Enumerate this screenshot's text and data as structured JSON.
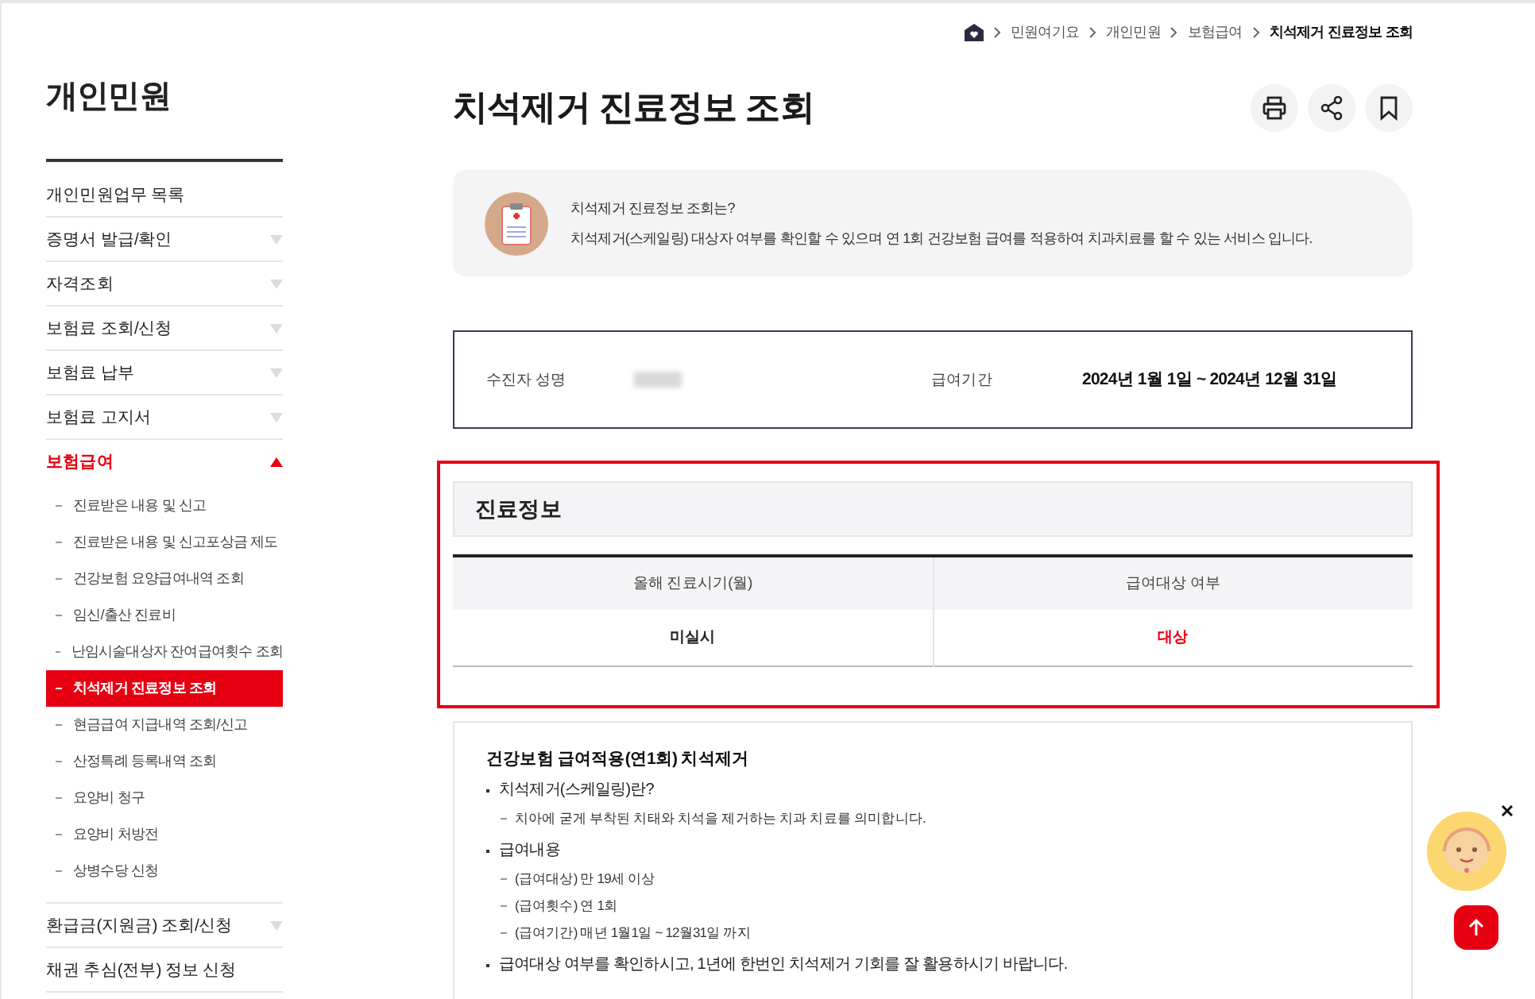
{
  "sidebar": {
    "title": "개인민원",
    "items": [
      {
        "label": "개인민원업무 목록",
        "kind": "link",
        "expanded": false
      },
      {
        "label": "증명서 발급/확인",
        "kind": "group",
        "expanded": false
      },
      {
        "label": "자격조회",
        "kind": "group",
        "expanded": false
      },
      {
        "label": "보험료 조회/신청",
        "kind": "group",
        "expanded": false
      },
      {
        "label": "보험료 납부",
        "kind": "group",
        "expanded": false
      },
      {
        "label": "보험료 고지서",
        "kind": "group",
        "expanded": false
      },
      {
        "label": "보험급여",
        "kind": "group",
        "expanded": true,
        "children": [
          {
            "label": "진료받은 내용 및 신고",
            "selected": false
          },
          {
            "label": "진료받은 내용 및 신고포상금 제도",
            "selected": false
          },
          {
            "label": "건강보험 요양급여내역 조회",
            "selected": false
          },
          {
            "label": "임신/출산 진료비",
            "selected": false
          },
          {
            "label": "난임시술대상자 잔여급여횟수 조회",
            "selected": false
          },
          {
            "label": "치석제거 진료정보 조회",
            "selected": true
          },
          {
            "label": "현금급여 지급내역 조회/신고",
            "selected": false
          },
          {
            "label": "산정특례 등록내역 조회",
            "selected": false
          },
          {
            "label": "요양비 청구",
            "selected": false
          },
          {
            "label": "요양비 처방전",
            "selected": false
          },
          {
            "label": "상병수당 신청",
            "selected": false
          }
        ]
      },
      {
        "label": "환급금(지원금) 조회/신청",
        "kind": "group",
        "expanded": false
      },
      {
        "label": "채권 추심(전부) 정보 신청",
        "kind": "link",
        "expanded": false
      }
    ]
  },
  "breadcrumb": [
    "민원여기요",
    "개인민원",
    "보험급여",
    "치석제거 진료정보 조회"
  ],
  "page_title": "치석제거 진료정보 조회",
  "intro": {
    "question": "치석제거 진료정보 조회는?",
    "description": "치석제거(스케일링) 대상자 여부를 확인할 수 있으며 연 1회 건강보험 급여를 적용하여 치과치료를 할 수 있는 서비스 입니다."
  },
  "recipient": {
    "name_label": "수진자 성명",
    "period_label": "급여기간",
    "period": "2024년 1월 1일 ~ 2024년 12월 31일"
  },
  "care_info": {
    "title": "진료정보",
    "columns": [
      "올해 진료시기(월)",
      "급여대상 여부"
    ],
    "row": [
      "미실시",
      "대상"
    ]
  },
  "notice": {
    "title": "건강보험 급여적용(연1회) 치석제거",
    "items": [
      {
        "text": "치석제거(스케일링)란?",
        "details": [
          "치아에 굳게 부착된 치태와 치석을 제거하는 치과 치료를 의미합니다."
        ]
      },
      {
        "text": "급여내용",
        "details": [
          "(급여대상) 만 19세 이상",
          "(급여횟수) 연 1회",
          "(급여기간) 매년 1월1일 ~ 12월31일 까지"
        ]
      },
      {
        "text": "급여대상 여부를 확인하시고, 1년에 한번인 치석제거 기회를 잘 활용하시기 바랍니다."
      }
    ]
  }
}
